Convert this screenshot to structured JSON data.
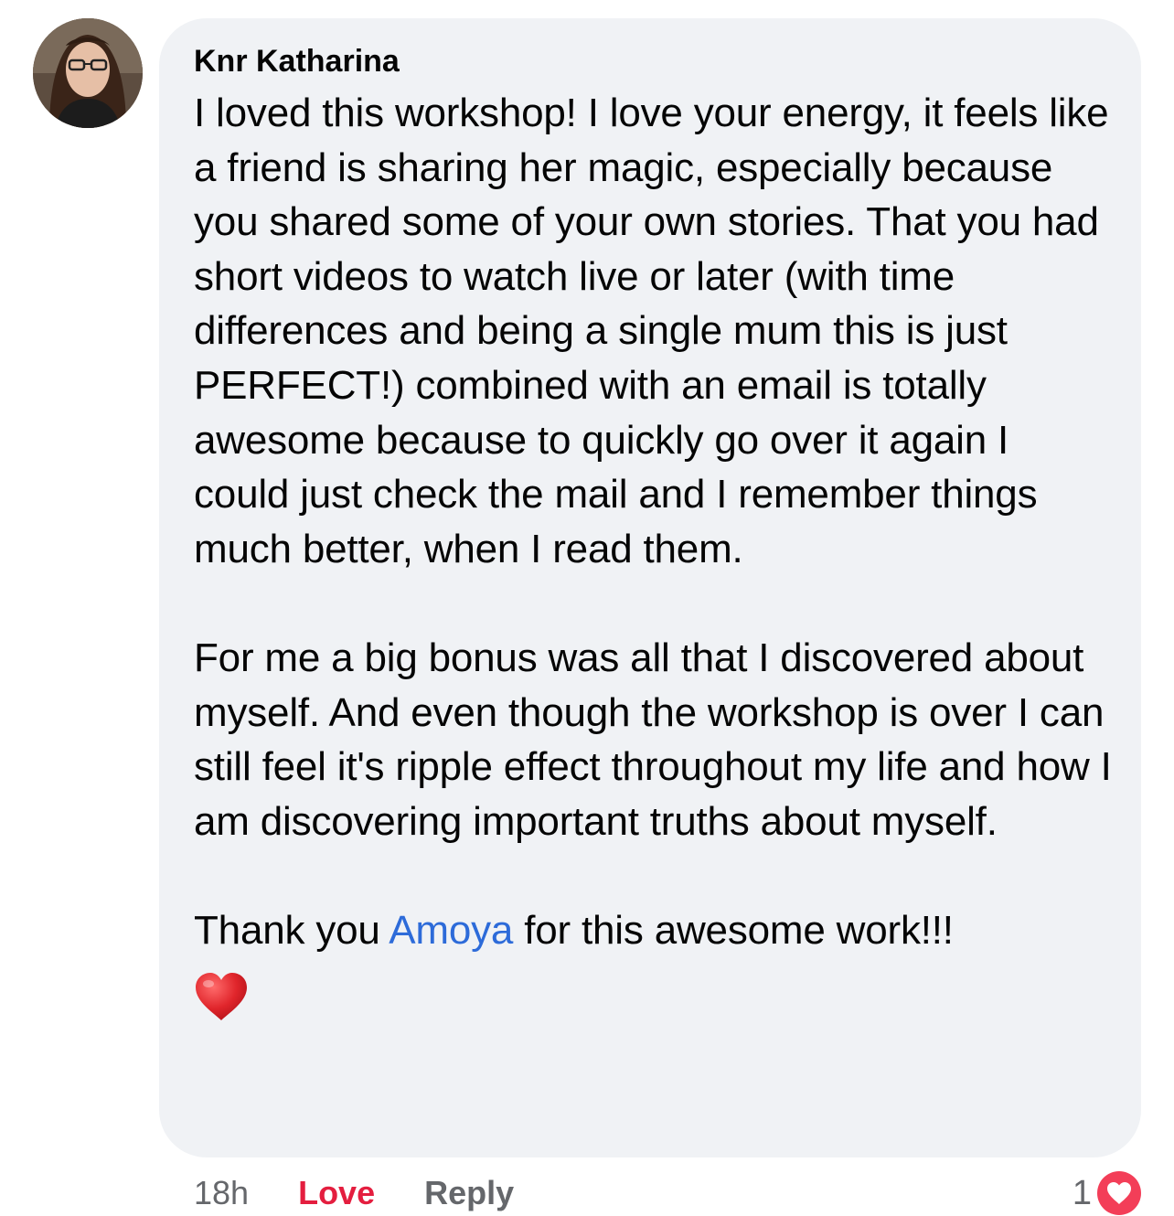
{
  "comment": {
    "author": "Knr Katharina",
    "paragraph1": "I loved this workshop! I love your energy, it feels like a friend is sharing her magic, especially because you shared some of your own stories. That you had short videos to watch live or later (with time differences and being a single mum this is just PERFECT!) combined with an email is totally awesome because to quickly go over it again I could just check the mail and I remember things much better, when I read them.",
    "paragraph2": "For me a big bonus was all that I discovered about myself. And even though the workshop is over I can still feel it's ripple effect throughout my life and how I am discovering important truths about myself.",
    "thanks_before": "Thank you ",
    "mention": "Amoya",
    "thanks_after": " for this awesome work!!!",
    "emoji": "heart-emoji"
  },
  "actions": {
    "time": "18h",
    "love_label": "Love",
    "reply_label": "Reply"
  },
  "reactions": {
    "count": "1",
    "type": "heart-icon"
  },
  "colors": {
    "bubble": "#f0f2f5",
    "mention": "#2d6bd9",
    "love": "#e41e3f",
    "muted": "#65676b",
    "reaction": "#f33e58"
  }
}
